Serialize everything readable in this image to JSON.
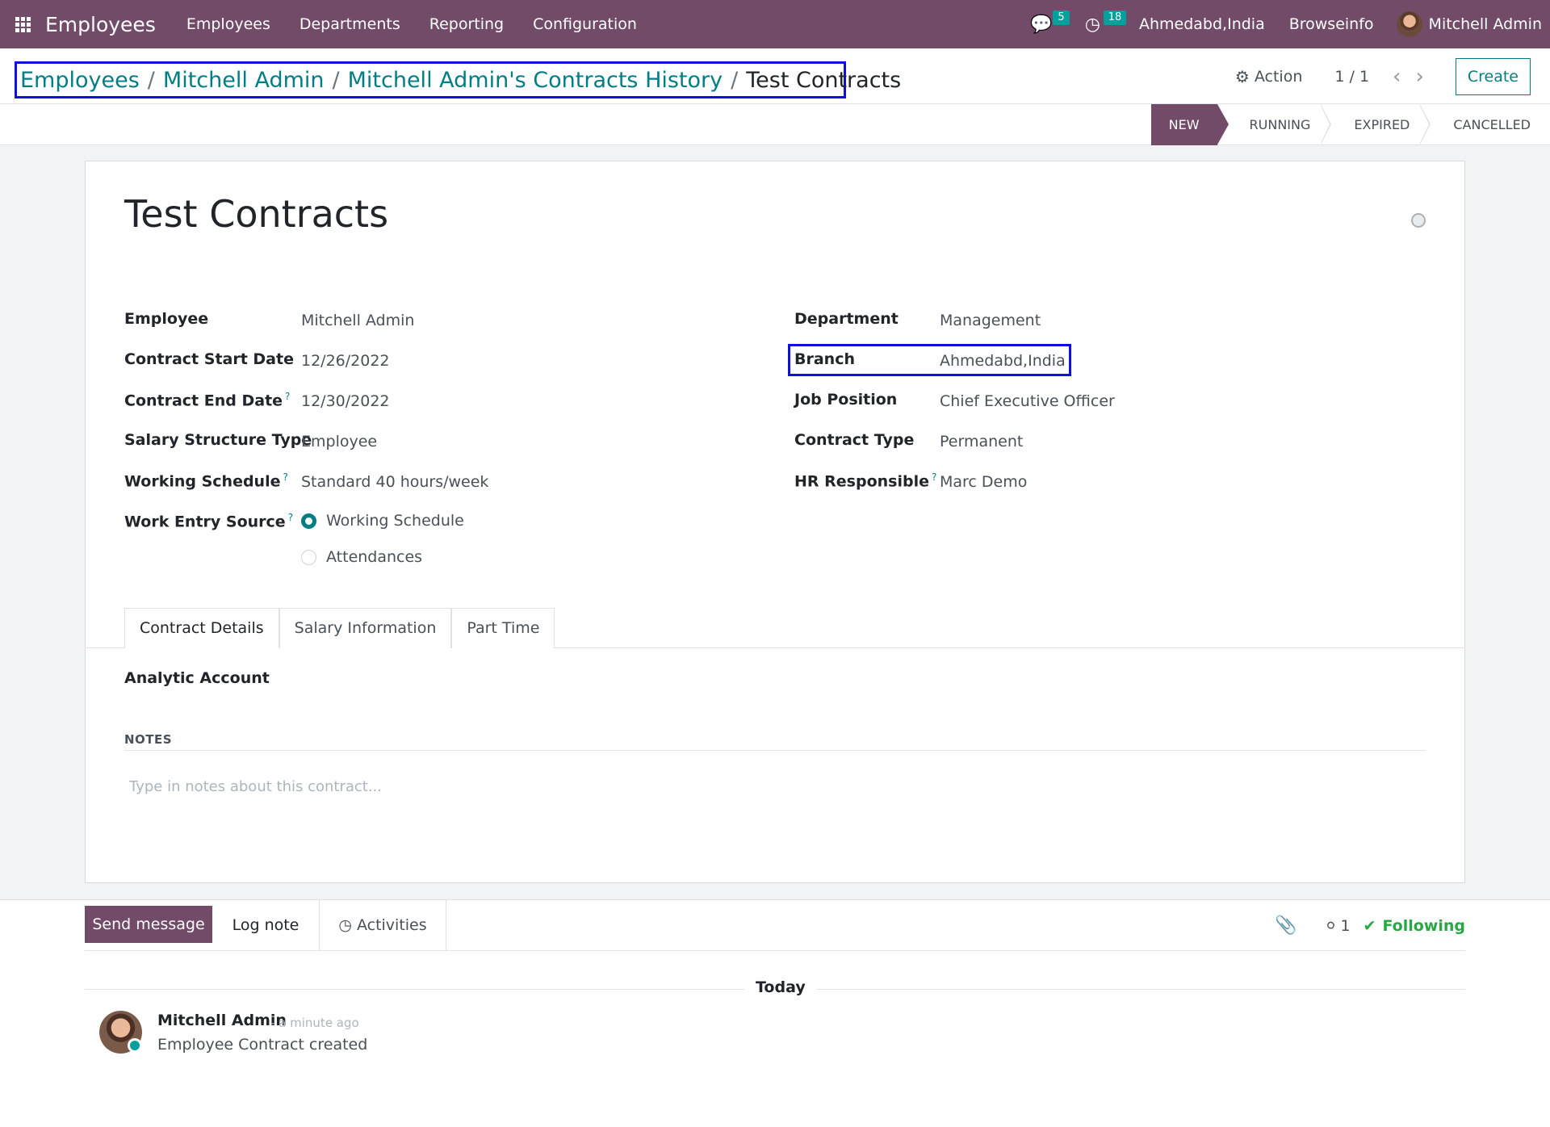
{
  "navbar": {
    "app_name": "Employees",
    "menu": [
      "Employees",
      "Departments",
      "Reporting",
      "Configuration"
    ],
    "messages_count": "5",
    "activities_count": "18",
    "branch": "Ahmedabd,India",
    "company": "Browseinfo",
    "user": "Mitchell Admin"
  },
  "breadcrumb": {
    "items": [
      "Employees",
      "Mitchell Admin",
      "Mitchell Admin's Contracts History"
    ],
    "current": "Test Contracts",
    "separator": "/"
  },
  "control": {
    "action_label": "Action",
    "pager": "1 / 1",
    "create_label": "Create"
  },
  "stages": {
    "items": [
      "NEW",
      "RUNNING",
      "EXPIRED",
      "CANCELLED"
    ],
    "active": "NEW"
  },
  "form": {
    "title": "Test Contracts",
    "left_fields": [
      {
        "label": "Employee",
        "value": "Mitchell Admin",
        "help": ""
      },
      {
        "label": "Contract Start Date",
        "value": "12/26/2022",
        "help": ""
      },
      {
        "label": "Contract End Date",
        "value": "12/30/2022",
        "help": "?"
      },
      {
        "label": "Salary Structure Type",
        "value": "Employee",
        "help": ""
      },
      {
        "label": "Working Schedule",
        "value": "Standard 40 hours/week",
        "help": "?"
      }
    ],
    "work_entry_source": {
      "label": "Work Entry Source",
      "help": "?",
      "options": [
        "Working Schedule",
        "Attendances"
      ],
      "selected": "Working Schedule"
    },
    "right_fields": [
      {
        "label": "Department",
        "value": "Management",
        "help": ""
      },
      {
        "label": "Branch",
        "value": "Ahmedabd,India",
        "help": ""
      },
      {
        "label": "Job Position",
        "value": "Chief Executive Officer",
        "help": ""
      },
      {
        "label": "Contract Type",
        "value": "Permanent",
        "help": ""
      },
      {
        "label": "HR Responsible",
        "value": "Marc Demo",
        "help": "?"
      }
    ],
    "tabs": [
      "Contract Details",
      "Salary Information",
      "Part Time"
    ],
    "active_tab": "Contract Details",
    "analytic_account_label": "Analytic Account",
    "notes_label": "NOTES",
    "notes_placeholder": "Type in notes about this contract..."
  },
  "chatter": {
    "send_message": "Send message",
    "log_note": "Log note",
    "activities": "Activities",
    "followers_count": "1",
    "following": "Following",
    "today": "Today",
    "message": {
      "author": "Mitchell Admin",
      "time": "- a minute ago",
      "body": "Employee Contract created"
    }
  },
  "colors": {
    "primary": "#714b67",
    "accent": "#017e84",
    "highlight_box": "#1010d8",
    "following": "#28a745"
  },
  "icons": [
    "apps-grid-icon",
    "chat-icon",
    "clock-icon",
    "gear-icon",
    "chevron-left-icon",
    "chevron-right-icon",
    "paperclip-icon",
    "user-icon",
    "check-icon"
  ]
}
